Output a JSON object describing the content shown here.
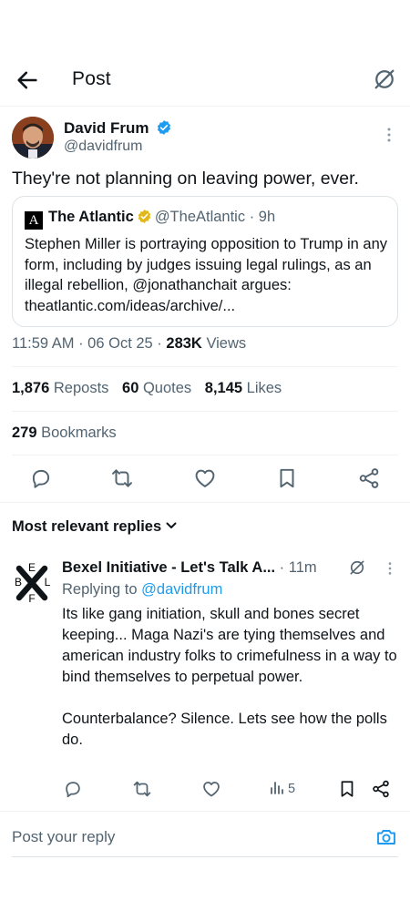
{
  "header": {
    "title": "Post"
  },
  "author": {
    "name": "David Frum",
    "handle": "@davidfrum"
  },
  "post": {
    "text": "They're not planning on leaving power, ever."
  },
  "quote": {
    "logo_letter": "A",
    "name": "The Atlantic",
    "handle": "@TheAtlantic",
    "time": "· 9h",
    "text": "Stephen Miller is portraying opposition to Trump in any form, including by judges issuing legal rulings, as an illegal rebellion, @jonathanchait argues: theatlantic.com/ideas/archive/..."
  },
  "meta": {
    "time": "11:59 AM",
    "date": "06 Oct 25",
    "views_count": "283K",
    "views_label": "Views"
  },
  "stats": {
    "reposts_count": "1,876",
    "reposts_label": "Reposts",
    "quotes_count": "60",
    "quotes_label": "Quotes",
    "likes_count": "8,145",
    "likes_label": "Likes",
    "bookmarks_count": "279",
    "bookmarks_label": "Bookmarks"
  },
  "replies": {
    "sort_label": "Most relevant replies",
    "items": [
      {
        "avatar_letters": {
          "top": "E",
          "left": "B",
          "right": "L",
          "bottom": "F"
        },
        "name": "Bexel Initiative - Let's Talk A...",
        "time": "· 11m",
        "replying_prefix": "Replying to",
        "replying_to": "@davidfrum",
        "text": "Its like gang initiation, skull and bones secret keeping... Maga Nazi's are tying themselves and american industry folks to crimefulness in a way to bind themselves to perpetual power.\n\nCounterbalance? Silence. Lets see how the polls do.",
        "views": "5"
      }
    ]
  },
  "composer": {
    "placeholder": "Post your reply"
  },
  "colors": {
    "accent": "#1d9bf0",
    "text": "#0f1419",
    "muted": "#536471",
    "gold": "#e2b719",
    "divider": "#eff3f4"
  }
}
